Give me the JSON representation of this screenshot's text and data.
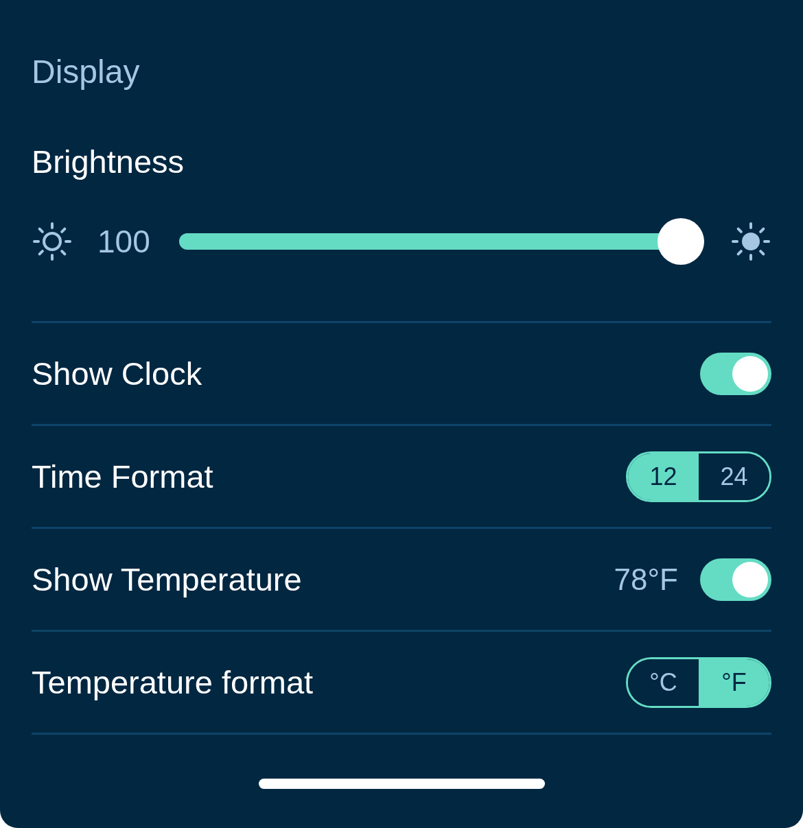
{
  "title": "Display",
  "brightness": {
    "label": "Brightness",
    "value": "100",
    "level": 1
  },
  "rows": [
    {
      "kind": "toggle",
      "label": "Show Clock",
      "on": true
    },
    {
      "kind": "segmented",
      "label": "Time Format",
      "options": [
        {
          "label": "12",
          "selected": true
        },
        {
          "label": "24",
          "selected": false
        }
      ]
    },
    {
      "kind": "toggle",
      "label": "Show Temperature",
      "reading": "78°F",
      "on": true
    },
    {
      "kind": "segmented",
      "label": "Temperature format",
      "options": [
        {
          "label": "°C",
          "selected": false
        },
        {
          "label": "°F",
          "selected": true
        }
      ]
    }
  ]
}
